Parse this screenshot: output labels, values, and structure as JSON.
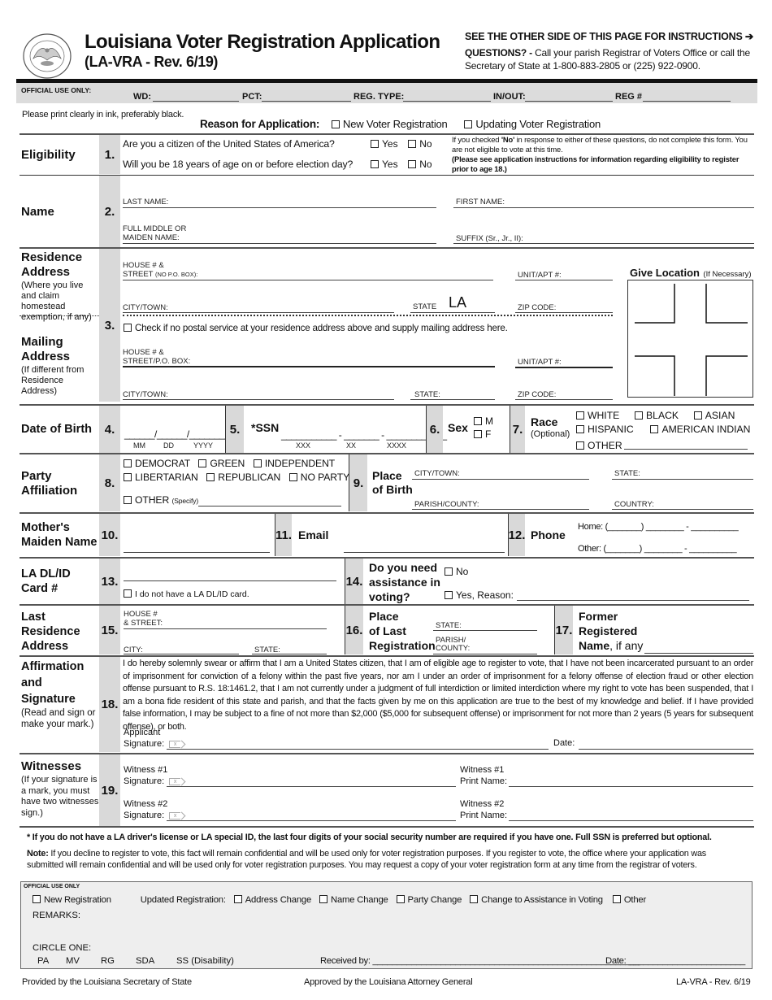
{
  "header": {
    "title": "Louisiana Voter Registration Application",
    "subtitle": "(LA-VRA - Rev. 6/19)",
    "see_other_side": "SEE THE OTHER SIDE OF THIS PAGE FOR INSTRUCTIONS",
    "arrow_icon": "➔",
    "questions_label": "QUESTIONS? -",
    "questions_text": "Call your parish Registrar of Voters Office or call the Secretary of State at 1-800-883-2805 or (225) 922-0900.",
    "seal_label": "State of Louisiana Secretary of State seal"
  },
  "official_top": {
    "label": "OFFICIAL USE ONLY:",
    "wd": "WD:",
    "pct": "PCT:",
    "reg_type": "REG. TYPE:",
    "in_out": "IN/OUT:",
    "reg_num": "REG #"
  },
  "intro": {
    "print_note": "Please print clearly in ink, preferably black.",
    "reason_label": "Reason for Application:",
    "reason_new": "New Voter Registration",
    "reason_update": "Updating Voter Registration"
  },
  "eligibility": {
    "section": "Eligibility",
    "num": "1.",
    "q1": "Are you a citizen of the United States of America?",
    "q2": "Will you be 18 years of age on or before election day?",
    "yes": "Yes",
    "no": "No",
    "note_prefix": "If you checked ",
    "note_no": "'No'",
    "note_rest": " in response to either of these questions, do not complete this form. You are not eligible to vote at this time.",
    "note_bold": "(Please see application instructions for information regarding eligibility to register prior to age 18.)"
  },
  "name": {
    "section": "Name",
    "num": "2.",
    "last": "LAST NAME:",
    "first": "FIRST NAME:",
    "middle_1": "FULL MIDDLE OR",
    "middle_2": "MAIDEN NAME:",
    "suffix": "SUFFIX (Sr., Jr., II):"
  },
  "residence": {
    "section": "Residence Address",
    "sub": "(Where you live and claim homestead exemption, if any)",
    "num": "3.",
    "house_1": "HOUSE # &",
    "house_2": "STREET",
    "house_2_small": "(NO P.O. BOX):",
    "unit": "UNIT/APT #:",
    "city": "CITY/TOWN:",
    "state_label": "STATE",
    "state_value": "LA",
    "zip": "ZIP CODE:",
    "give_location": "Give Location",
    "give_location_sub": "(If Necessary)"
  },
  "mailing": {
    "section": "Mailing Address",
    "sub": "(If different from Residence Address)",
    "no_postal": "Check if no postal service at your residence address above and supply mailing address here.",
    "house_1": "HOUSE # &",
    "house_2": "STREET/P.O. BOX:",
    "unit": "UNIT/APT #:",
    "city": "CITY/TOWN:",
    "state": "STATE:",
    "zip": "ZIP CODE:"
  },
  "dob": {
    "section": "Date of Birth",
    "num": "4.",
    "mm": "MM",
    "dd": "DD",
    "yyyy": "YYYY"
  },
  "ssn": {
    "num": "5.",
    "label": "*SSN",
    "p1": "XXX",
    "p2": "XX",
    "p3": "XXXX"
  },
  "sex": {
    "num": "6.",
    "label": "Sex",
    "m": "M",
    "f": "F"
  },
  "race": {
    "num": "7.",
    "label": "Race",
    "sub": "(Optional)",
    "options": [
      "WHITE",
      "BLACK",
      "ASIAN",
      "HISPANIC",
      "AMERICAN INDIAN",
      "OTHER"
    ]
  },
  "party": {
    "section": "Party Affiliation",
    "num": "8.",
    "options": [
      "DEMOCRAT",
      "GREEN",
      "INDEPENDENT",
      "LIBERTARIAN",
      "REPUBLICAN",
      "NO PARTY"
    ],
    "other": "OTHER",
    "other_sub": "(Specify)"
  },
  "birthplace": {
    "num": "9.",
    "label_1": "Place",
    "label_2": "of Birth",
    "city": "CITY/TOWN:",
    "state": "STATE:",
    "parish": "PARISH/COUNTY:",
    "country": "COUNTRY:"
  },
  "mother": {
    "section": "Mother's Maiden Name",
    "num": "10."
  },
  "email": {
    "num": "11.",
    "label": "Email"
  },
  "phone": {
    "num": "12.",
    "label": "Phone",
    "home": "Home: (_______) ________ - __________",
    "other": "Other:  (_______) ________ - __________"
  },
  "dl": {
    "section": "LA DL/ID Card #",
    "num": "13.",
    "no_card": "I do not have a LA DL/ID card."
  },
  "assistance": {
    "num": "14.",
    "label_1": "Do you need",
    "label_2": "assistance in",
    "label_3": "voting?",
    "no": "No",
    "yes": "Yes, Reason:"
  },
  "last_residence": {
    "section": "Last Residence Address",
    "num": "15.",
    "house_1": "HOUSE #",
    "house_2": "& STREET:",
    "city": "CITY:",
    "state": "STATE:"
  },
  "last_registration": {
    "num": "16.",
    "label_1": "Place",
    "label_2": "of Last",
    "label_3": "Registration",
    "state": "STATE:",
    "parish_1": "PARISH/",
    "parish_2": "COUNTY:"
  },
  "former_name": {
    "num": "17.",
    "label_1": "Former",
    "label_2": "Registered",
    "label_3": "Name",
    "label_4": ", if any"
  },
  "affirmation": {
    "section": "Affirmation and Signature",
    "sub": "(Read and sign or make your mark.)",
    "num": "18.",
    "text": "I do hereby solemnly swear or affirm that I am a United States citizen, that I am of eligible age to register to vote, that I have not been incarcerated pursuant to an order of imprisonment for conviction of a felony within the past five years, nor am I under an order of imprisonment for a felony offense of election fraud or other election offense pursuant to R.S. 18:1461.2, that I am not currently under a judgment of full interdiction or limited interdiction where my right to vote has been suspended, that I am a bona fide resident of this state and parish, and that the facts given by me on this application are true to the best of my knowledge and belief. If I have provided false information, I may be subject to a fine of not more than $2,000 ($5,000 for subsequent offense) or imprisonment for not more than 2 years (5 years for subsequent offense), or both.",
    "applicant_1": "Applicant",
    "applicant_2": "Signature:",
    "date": "Date:"
  },
  "witnesses": {
    "section": "Witnesses",
    "sub": "(If your signature is a mark, you must have two witnesses sign.)",
    "num": "19.",
    "w1_sig_1": "Witness #1",
    "w1_sig_2": "Signature:",
    "w1_name_1": "Witness #1",
    "w1_name_2": "Print Name:",
    "w2_sig_1": "Witness #2",
    "w2_sig_2": "Signature:",
    "w2_name_1": "Witness #2",
    "w2_name_2": "Print Name:"
  },
  "notes": {
    "ssn_note": "* If you do not have a LA driver's license or LA special ID, the last four digits of your social security number are required if you have one. Full SSN is preferred but optional.",
    "note_label": "Note:",
    "note_text": " If you decline to register to vote, this fact will remain confidential and will be used only for voter registration purposes. If you register to vote, the office where your application was submitted will remain confidential and will be used only for voter registration purposes. You may request a copy of your voter registration form at any time from the registrar of voters."
  },
  "official_bottom": {
    "label": "OFFICIAL USE ONLY",
    "new_reg": "New Registration",
    "updated": "Updated Registration:",
    "options": [
      "Address Change",
      "Name Change",
      "Party Change",
      "Change to Assistance in Voting",
      "Other"
    ],
    "remarks": "REMARKS:",
    "circle_one": "CIRCLE ONE:",
    "circle_options": [
      "PA",
      "MV",
      "RG",
      "SDA",
      "SS (Disability)"
    ],
    "received_by": "Received by: _______________________________________________________",
    "date": "Date: ________________________"
  },
  "footer": {
    "left": "Provided by the Louisiana Secretary of State",
    "center": "Approved by the Louisiana Attorney General",
    "right": "LA-VRA - Rev. 6/19"
  }
}
